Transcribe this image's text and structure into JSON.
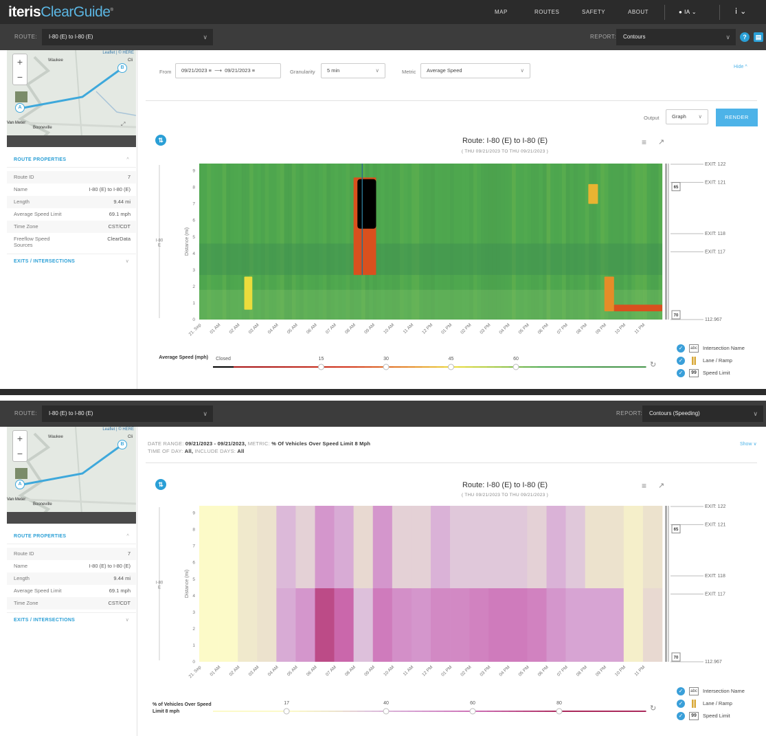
{
  "app": {
    "logo_a": "iteris",
    "logo_b": "ClearGuide",
    "tm": "®"
  },
  "nav": [
    "MAP",
    "ROUTES",
    "SAFETY",
    "ABOUT"
  ],
  "state": "IA",
  "route_label": "ROUTE:",
  "route_value": "I-80 (E) to I-80 (E)",
  "report_label": "REPORT:",
  "map": {
    "attribution": "Leaflet | © HERE",
    "places": [
      "Waukee",
      "Van Meter",
      "Booneville",
      "Cli"
    ],
    "marker_a": "A",
    "marker_b": "B",
    "zoom_in": "+",
    "zoom_out": "−"
  },
  "route_properties": {
    "title": "ROUTE PROPERTIES",
    "exits_title": "EXITS / INTERSECTIONS"
  },
  "panel1": {
    "report_value": "Contours",
    "props": [
      [
        "Route ID",
        "7"
      ],
      [
        "Name",
        "I-80 (E) to I-80 (E)"
      ],
      [
        "Length",
        "9.44 mi"
      ],
      [
        "Average Speed Limit",
        "69.1 mph"
      ],
      [
        "Time Zone",
        "CST/CDT"
      ],
      [
        "Freeflow Speed Sources",
        "ClearData"
      ]
    ],
    "from_label": "From",
    "from_date": "09/21/2023",
    "to_date": "09/21/2023",
    "granularity_label": "Granularity",
    "granularity": "5 min",
    "metric_label": "Metric",
    "metric": "Average Speed",
    "hide": "Hide ^",
    "output_label": "Output",
    "output": "Graph",
    "render": "RENDER",
    "title": "Route: I-80 (E) to I-80 (E)",
    "subtitle": "( THU 09/21/2023 TO THU 09/21/2023 )",
    "scale_title": "Average Speed (mph)",
    "scale_closed": "Closed",
    "scale_ticks": [
      "15",
      "30",
      "45",
      "60"
    ]
  },
  "panel2": {
    "report_value": "Contours (Speeding)",
    "props": [
      [
        "Route ID",
        "7"
      ],
      [
        "Name",
        "I-80 (E) to I-80 (E)"
      ],
      [
        "Length",
        "9.44 mi"
      ],
      [
        "Average Speed Limit",
        "69.1 mph"
      ],
      [
        "Time Zone",
        "CST/CDT"
      ]
    ],
    "summary_line1_a": "DATE RANGE:",
    "summary_line1_b": "09/21/2023 - 09/21/2023,",
    "summary_line1_c": "METRIC:",
    "summary_line1_d": "% Of Vehicles Over Speed Limit 8 Mph",
    "summary_line2_a": "TIME OF DAY:",
    "summary_line2_b": "All,",
    "summary_line2_c": "INCLUDE DAYS:",
    "summary_line2_d": "All",
    "show": "Show ∨",
    "title": "Route: I-80 (E) to I-80 (E)",
    "subtitle": "( THU 09/21/2023 TO THU 09/21/2023 )",
    "scale_title": "% of Vehicles Over Speed Limit 8 mph",
    "scale_ticks": [
      "17",
      "40",
      "60",
      "80"
    ]
  },
  "legend": {
    "intersection": "Intersection Name",
    "intersection_box": "abc",
    "lane": "Lane / Ramp",
    "speed": "Speed Limit",
    "speed_box": "99"
  },
  "chart_data": [
    {
      "type": "heatmap",
      "title": "Route: I-80 (E) to I-80 (E)",
      "subtitle": "( THU 09/21/2023 TO THU 09/21/2023 )",
      "metric": "Average Speed (mph)",
      "xlabel": "",
      "ylabel": "Distance (mi)",
      "route_axis_label": "I-80 E",
      "x_ticks": [
        "21. Sep",
        "01 AM",
        "02 AM",
        "03 AM",
        "04 AM",
        "05 AM",
        "06 AM",
        "07 AM",
        "08 AM",
        "09 AM",
        "10 AM",
        "11 AM",
        "12 PM",
        "01 PM",
        "02 PM",
        "03 PM",
        "04 PM",
        "05 PM",
        "06 PM",
        "07 PM",
        "08 PM",
        "09 PM",
        "10 PM",
        "11 PM"
      ],
      "y_ticks": [
        "0",
        "1",
        "2",
        "3",
        "4",
        "5",
        "6",
        "7",
        "8",
        "9"
      ],
      "ylim": [
        0,
        9.44
      ],
      "exits": [
        {
          "label": "EXIT: 122",
          "mile": 9.4
        },
        {
          "label": "EXIT: 121",
          "mile": 8.3
        },
        {
          "label": "EXIT: 118",
          "mile": 5.2
        },
        {
          "label": "EXIT: 117",
          "mile": 4.1
        },
        {
          "label": "112.967",
          "mile": 0
        }
      ],
      "speed_limits": [
        {
          "label": "65",
          "mile": 8.0
        },
        {
          "label": "70",
          "mile": 0.0
        }
      ],
      "events": [
        {
          "desc": "closure",
          "start": "08:12",
          "end": "09:10",
          "from_mile": 5.5,
          "to_mile": 8.5,
          "value": "Closed"
        },
        {
          "desc": "congestion",
          "start": "08:00",
          "end": "09:10",
          "from_mile": 2.7,
          "to_mile": 8.6,
          "value": 25
        },
        {
          "desc": "congestion",
          "start": "02:20",
          "end": "02:45",
          "from_mile": 0.6,
          "to_mile": 2.6,
          "value": 45
        },
        {
          "desc": "congestion",
          "start": "20:10",
          "end": "20:40",
          "from_mile": 7.0,
          "to_mile": 8.2,
          "value": 40
        },
        {
          "desc": "congestion",
          "start": "21:00",
          "end": "21:30",
          "from_mile": 0.5,
          "to_mile": 2.6,
          "value": 35
        },
        {
          "desc": "congestion",
          "start": "21:30",
          "end": "24:00",
          "from_mile": 0.5,
          "to_mile": 0.9,
          "value": 25
        }
      ]
    },
    {
      "type": "heatmap",
      "title": "Route: I-80 (E) to I-80 (E)",
      "subtitle": "( THU 09/21/2023 TO THU 09/21/2023 )",
      "metric": "% of Vehicles Over Speed Limit 8 mph",
      "xlabel": "",
      "ylabel": "Distance (mi)",
      "route_axis_label": "I-80 E",
      "x_ticks": [
        "21. Sep",
        "01 AM",
        "02 AM",
        "03 AM",
        "04 AM",
        "05 AM",
        "06 AM",
        "07 AM",
        "08 AM",
        "09 AM",
        "10 AM",
        "11 AM",
        "12 PM",
        "01 PM",
        "02 PM",
        "03 PM",
        "04 PM",
        "05 PM",
        "06 PM",
        "07 PM",
        "08 PM",
        "09 PM",
        "10 PM",
        "11 PM"
      ],
      "y_ticks": [
        "0",
        "1",
        "2",
        "3",
        "4",
        "5",
        "6",
        "7",
        "8",
        "9"
      ],
      "ylim": [
        0,
        9.44
      ],
      "exits": [
        {
          "label": "EXIT: 122",
          "mile": 9.4
        },
        {
          "label": "EXIT: 121",
          "mile": 8.3
        },
        {
          "label": "EXIT: 118",
          "mile": 5.2
        },
        {
          "label": "EXIT: 117",
          "mile": 4.1
        },
        {
          "label": "112.967",
          "mile": 0
        }
      ],
      "speed_limits": [
        {
          "label": "65",
          "mile": 8.0
        },
        {
          "label": "70",
          "mile": 0.0
        }
      ],
      "hours": [
        0,
        1,
        2,
        3,
        4,
        5,
        6,
        7,
        8,
        9,
        10,
        11,
        12,
        13,
        14,
        15,
        16,
        17,
        18,
        19,
        20,
        21,
        22,
        23
      ],
      "segments": [
        {
          "from_mile": 4.45,
          "to_mile": 9.44,
          "values": [
            17,
            17,
            25,
            28,
            38,
            32,
            48,
            42,
            30,
            48,
            32,
            32,
            40,
            34,
            34,
            34,
            34,
            32,
            40,
            34,
            28,
            28,
            22,
            28
          ]
        },
        {
          "from_mile": 0,
          "to_mile": 4.45,
          "values": [
            17,
            17,
            25,
            28,
            42,
            48,
            70,
            62,
            36,
            56,
            50,
            48,
            52,
            52,
            54,
            56,
            56,
            54,
            48,
            44,
            44,
            44,
            22,
            30
          ]
        }
      ]
    }
  ]
}
